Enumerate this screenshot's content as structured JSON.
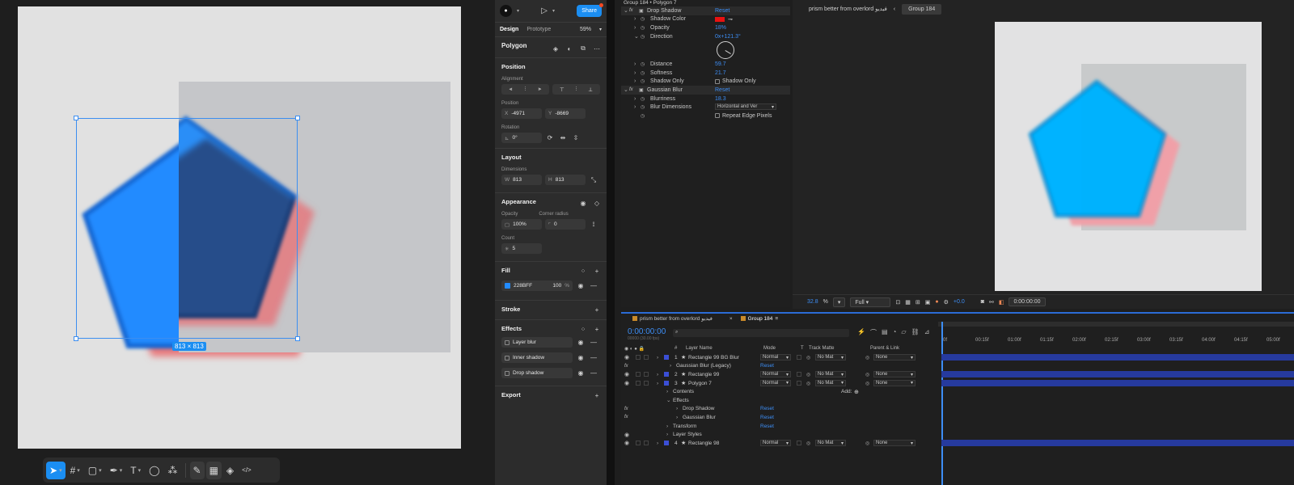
{
  "figma": {
    "dim_badge": "813 × 813",
    "toolbar": {
      "tools": [
        {
          "name": "move-tool",
          "glyph": "➤",
          "active": true
        },
        {
          "name": "frame-tool",
          "glyph": "#"
        },
        {
          "name": "rectangle-tool",
          "glyph": "▢"
        },
        {
          "name": "pen-tool",
          "glyph": "✒"
        },
        {
          "name": "text-tool",
          "glyph": "T"
        },
        {
          "name": "comment-tool",
          "glyph": "◯"
        },
        {
          "name": "actions-tool",
          "glyph": "⁂"
        }
      ],
      "dev_tools": [
        "✎",
        "▦",
        "◈",
        "</>"
      ]
    },
    "help": "?",
    "panel": {
      "share": "Share",
      "tabs": [
        "Design",
        "Prototype"
      ],
      "zoom": "59%",
      "object_name": "Polygon",
      "position": {
        "title": "Position",
        "alignment_label": "Alignment",
        "position_label": "Position",
        "x_key": "X",
        "x": "-4971",
        "y_key": "Y",
        "y": "-8669",
        "rotation_label": "Rotation",
        "rotation": "0°"
      },
      "layout": {
        "title": "Layout",
        "dimensions_label": "Dimensions",
        "w_key": "W",
        "w": "813",
        "h_key": "H",
        "h": "813"
      },
      "appearance": {
        "title": "Appearance",
        "opacity_label": "Opacity",
        "opacity": "100%",
        "corner_label": "Corner radius",
        "corner": "0",
        "count_label": "Count",
        "count": "5"
      },
      "fill": {
        "title": "Fill",
        "hex": "228BFF",
        "opacity": "100",
        "pct": "%"
      },
      "stroke": {
        "title": "Stroke"
      },
      "effects": {
        "title": "Effects",
        "items": [
          "Layer blur",
          "Inner shadow",
          "Drop shadow"
        ]
      },
      "export": {
        "title": "Export"
      }
    }
  },
  "ae": {
    "effect_controls": {
      "title": "Group 184 • Polygon 7",
      "rows": [
        {
          "fx": true,
          "label": "Drop Shadow",
          "value": "Reset",
          "indent": 20,
          "hl": true
        },
        {
          "label": "Shadow Color",
          "indent": 20,
          "color": "#e81111"
        },
        {
          "label": "Opacity",
          "value": "18%",
          "indent": 20
        },
        {
          "label": "Direction",
          "value": "0x+121.3°",
          "indent": 20,
          "open": true
        },
        {
          "dial": true
        },
        {
          "label": "Distance",
          "value": "59.7",
          "indent": 20
        },
        {
          "label": "Softness",
          "value": "21.7",
          "indent": 20
        },
        {
          "label": "Shadow Only",
          "check": "Shadow Only",
          "indent": 20
        },
        {
          "fx": true,
          "label": "Gaussian Blur",
          "value": "Reset",
          "indent": 20,
          "hl": true
        },
        {
          "label": "Blurriness",
          "value": "18.3",
          "indent": 20
        },
        {
          "label": "Blur Dimensions",
          "dropdown": "Horizontal and Ver",
          "indent": 20
        },
        {
          "label": "",
          "check": "Repeat Edge Pixels",
          "indent": 20
        }
      ]
    },
    "viewer": {
      "comp_name": "prism better from overlord فيديو",
      "group_tab": "Group 184",
      "zoom": "32.8",
      "zoom_unit": "%",
      "resolution": "Full",
      "exposure": "+0.0",
      "timecode": "0:00:00:00"
    },
    "timeline": {
      "tabs": [
        "prism better from overlord فيديو",
        "Group 184"
      ],
      "time": "0:00:00:00",
      "fps": "00000 (30.00 fps)",
      "headers": {
        "num": "#",
        "name": "Layer Name",
        "mode": "Mode",
        "t": "T",
        "track": "Track Matte",
        "parent": "Parent & Link"
      },
      "ruler": [
        "0f",
        "00:15f",
        "01:00f",
        "01:15f",
        "02:00f",
        "02:15f",
        "03:00f",
        "03:15f",
        "04:00f",
        "04:15f",
        "05:00f"
      ],
      "add_label": "Add:",
      "layers": [
        {
          "type": "layer",
          "num": "1",
          "name": "Rectangle 99 BG Blur",
          "mode": "Normal",
          "matte": "No Mat",
          "parent": "None"
        },
        {
          "type": "fx",
          "name": "Gaussian Blur (Legacy)",
          "reset": "Reset",
          "indent": 68
        },
        {
          "type": "layer",
          "num": "2",
          "name": "Rectangle 99",
          "mode": "Normal",
          "matte": "No Mat",
          "parent": "None"
        },
        {
          "type": "layer",
          "num": "3",
          "name": "Polygon 7",
          "mode": "Normal",
          "matte": "No Mat",
          "parent": "None"
        },
        {
          "type": "group",
          "name": "Contents",
          "indent": 64,
          "add": true
        },
        {
          "type": "group",
          "name": "Effects",
          "indent": 64,
          "open": true
        },
        {
          "type": "fx",
          "name": "Drop Shadow",
          "reset": "Reset",
          "indent": 76
        },
        {
          "type": "fx",
          "name": "Gaussian Blur",
          "reset": "Reset",
          "indent": 76
        },
        {
          "type": "group",
          "name": "Transform",
          "reset": "Reset",
          "indent": 64
        },
        {
          "type": "group",
          "name": "Layer Styles",
          "indent": 64,
          "eye": true
        },
        {
          "type": "layer",
          "num": "4",
          "name": "Rectangle 98",
          "mode": "Normal",
          "matte": "No Mat",
          "parent": "None"
        }
      ]
    }
  }
}
